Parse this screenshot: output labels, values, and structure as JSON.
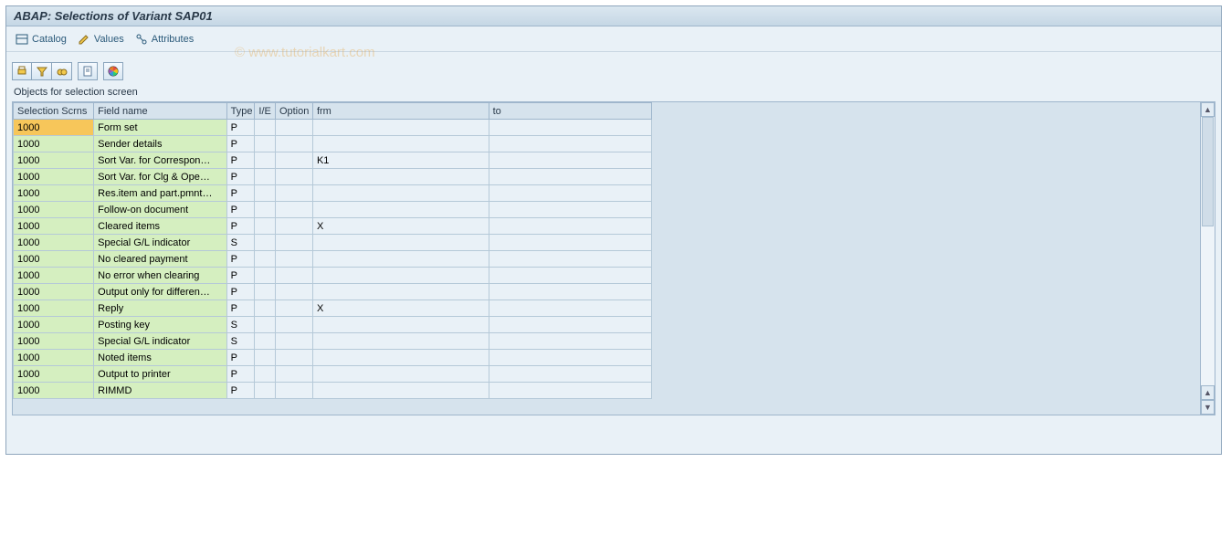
{
  "header": {
    "title": "ABAP: Selections of Variant SAP01"
  },
  "toolbar": {
    "catalog_label": "Catalog",
    "values_label": "Values",
    "attributes_label": "Attributes"
  },
  "watermark": "© www.tutorialkart.com",
  "panel": {
    "label": "Objects for selection screen"
  },
  "columns": {
    "scrn": "Selection Scrns",
    "fname": "Field name",
    "type": "Type",
    "ie": "I/E",
    "opt": "Option",
    "frm": "frm",
    "to": "to"
  },
  "rows": [
    {
      "scrn": "1000",
      "fname": "Form set",
      "type": "P",
      "ie": "",
      "opt": "",
      "frm": "",
      "to": "",
      "selected": true
    },
    {
      "scrn": "1000",
      "fname": "Sender details",
      "type": "P",
      "ie": "",
      "opt": "",
      "frm": "",
      "to": ""
    },
    {
      "scrn": "1000",
      "fname": "Sort Var. for Correspon…",
      "type": "P",
      "ie": "",
      "opt": "",
      "frm": "K1",
      "to": ""
    },
    {
      "scrn": "1000",
      "fname": "Sort Var. for Clg & Ope…",
      "type": "P",
      "ie": "",
      "opt": "",
      "frm": "",
      "to": ""
    },
    {
      "scrn": "1000",
      "fname": "Res.item and part.pmnt…",
      "type": "P",
      "ie": "",
      "opt": "",
      "frm": "",
      "to": ""
    },
    {
      "scrn": "1000",
      "fname": "Follow-on document",
      "type": "P",
      "ie": "",
      "opt": "",
      "frm": "",
      "to": ""
    },
    {
      "scrn": "1000",
      "fname": "Cleared items",
      "type": "P",
      "ie": "",
      "opt": "",
      "frm": "X",
      "to": ""
    },
    {
      "scrn": "1000",
      "fname": "Special G/L indicator",
      "type": "S",
      "ie": "",
      "opt": "",
      "frm": "",
      "to": ""
    },
    {
      "scrn": "1000",
      "fname": "No cleared payment",
      "type": "P",
      "ie": "",
      "opt": "",
      "frm": "",
      "to": ""
    },
    {
      "scrn": "1000",
      "fname": "No error when clearing",
      "type": "P",
      "ie": "",
      "opt": "",
      "frm": "",
      "to": ""
    },
    {
      "scrn": "1000",
      "fname": "Output only for differen…",
      "type": "P",
      "ie": "",
      "opt": "",
      "frm": "",
      "to": ""
    },
    {
      "scrn": "1000",
      "fname": "Reply",
      "type": "P",
      "ie": "",
      "opt": "",
      "frm": "X",
      "to": ""
    },
    {
      "scrn": "1000",
      "fname": "Posting key",
      "type": "S",
      "ie": "",
      "opt": "",
      "frm": "",
      "to": ""
    },
    {
      "scrn": "1000",
      "fname": "Special G/L indicator",
      "type": "S",
      "ie": "",
      "opt": "",
      "frm": "",
      "to": ""
    },
    {
      "scrn": "1000",
      "fname": "Noted items",
      "type": "P",
      "ie": "",
      "opt": "",
      "frm": "",
      "to": ""
    },
    {
      "scrn": "1000",
      "fname": "Output to printer",
      "type": "P",
      "ie": "",
      "opt": "",
      "frm": "",
      "to": ""
    },
    {
      "scrn": "1000",
      "fname": "RIMMD",
      "type": "P",
      "ie": "",
      "opt": "",
      "frm": "",
      "to": ""
    }
  ]
}
